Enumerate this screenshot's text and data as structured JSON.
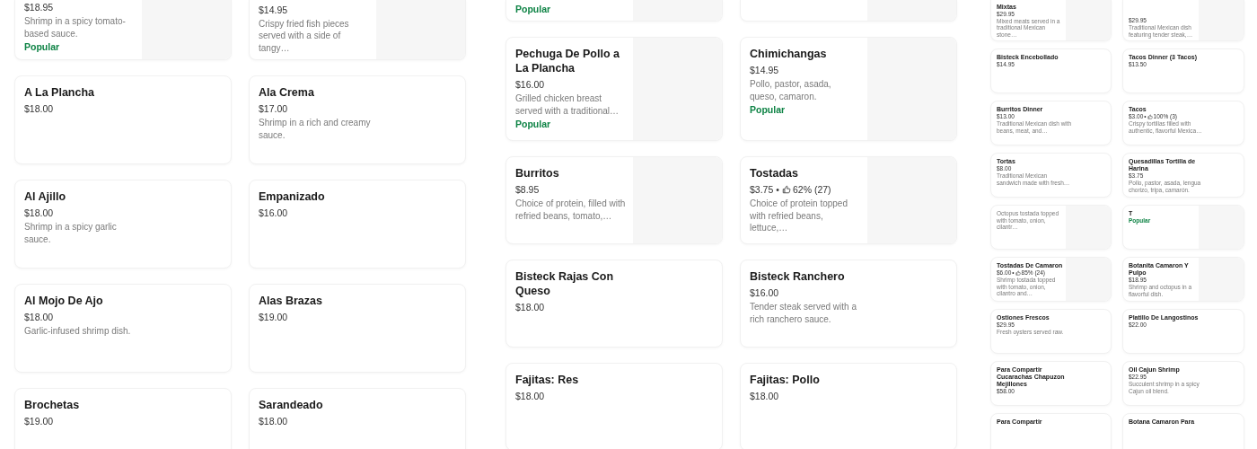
{
  "panels": [
    {
      "top_partial": [
        {
          "price": "$18.95",
          "description": "Shrimp in a spicy tomato-based sauce.",
          "badge": "Popular",
          "image": true
        },
        {
          "price": "$14.95",
          "description": "Crispy fried fish pieces served with a side of tangy…",
          "image": true
        }
      ],
      "rows": [
        [
          {
            "name": "A La Plancha",
            "price": "$18.00",
            "image": false
          },
          {
            "name": "Ala Crema",
            "price": "$17.00",
            "description": "Shrimp in a rich and creamy sauce.",
            "image": false
          }
        ],
        [
          {
            "name": "Al Ajillo",
            "price": "$18.00",
            "description": "Shrimp in a spicy garlic sauce.",
            "image": false
          },
          {
            "name": "Empanizado",
            "price": "$16.00",
            "image": false
          }
        ],
        [
          {
            "name": "Al Mojo De Ajo",
            "price": "$18.00",
            "description": "Garlic-infused shrimp dish.",
            "image": false
          },
          {
            "name": "Alas Brazas",
            "price": "$19.00",
            "image": false
          }
        ],
        [
          {
            "name": "Brochetas",
            "price": "$19.00",
            "image": false
          },
          {
            "name": "Sarandeado",
            "price": "$18.00",
            "image": false
          }
        ]
      ]
    },
    {
      "top_partial": [
        {
          "badge": "Popular",
          "image": true
        },
        {
          "image": true
        }
      ],
      "rows": [
        [
          {
            "name": "Pechuga De Pollo a La Plancha",
            "price": "$16.00",
            "description": "Grilled chicken breast served with a traditional…",
            "badge": "Popular",
            "image": true
          },
          {
            "name": "Chimichangas",
            "price": "$14.95",
            "description": "Pollo, pastor, asada, queso, camaron.",
            "badge": "Popular",
            "image": true
          }
        ],
        [
          {
            "name": "Burritos",
            "price": "$8.95",
            "description": "Choice of protein, filled with refried beans, tomato,…",
            "image": true
          },
          {
            "name": "Tostadas",
            "price": "$3.75",
            "rating_separator": "•",
            "rating": "62% (27)",
            "description": "Choice of protein topped with refried beans, lettuce,…",
            "image": true
          }
        ],
        [
          {
            "name": "Bisteck Rajas Con Queso",
            "price": "$18.00",
            "image": false
          },
          {
            "name": "Bisteck Ranchero",
            "price": "$16.00",
            "description": "Tender steak served with a rich ranchero sauce.",
            "image": false
          }
        ],
        [
          {
            "name": "Fajitas: Res",
            "price": "$18.00",
            "image": false
          },
          {
            "name": "Fajitas: Pollo",
            "price": "$18.00",
            "image": false
          }
        ]
      ]
    },
    {
      "top_partial": [
        {
          "name": "Mixtas",
          "price": "$29.95",
          "description": "Mixed meats served in a traditional Mexican stone…",
          "image": true
        },
        {
          "price": "$29.95",
          "description": "Traditional Mexican dish featuring tender steak,…",
          "image": true
        }
      ],
      "rows": [
        [
          {
            "name": "Bisteck Encebollado",
            "price": "$14.95",
            "image": false
          },
          {
            "name": "Tacos Dinner (3 Tacos)",
            "price": "$13.50",
            "image": false
          }
        ],
        [
          {
            "name": "Burritos Dinner",
            "price": "$13.00",
            "description": "Traditional Mexican dish with beans, meat, and…",
            "image": false
          },
          {
            "name": "Tacos",
            "price": "$3.00",
            "rating_separator": "•",
            "rating": "100% (3)",
            "description": "Crispy tortillas filled with authentic, flavorful Mexica…",
            "image": false
          }
        ],
        [
          {
            "name": "Tortas",
            "price": "$8.00",
            "description": "Traditional Mexican sandwich made with fresh…",
            "image": false
          },
          {
            "name": "Quesadillas Tortilla de Harina",
            "price": "$3.75",
            "description": "Pollo, pastor, asada, lengua chorizo, tripa, camarón.",
            "image": false
          }
        ],
        [
          {
            "description": "Octopus tostada topped with tomato, onion, cilantr…",
            "image": true
          },
          {
            "name": "T",
            "badge": "Popular",
            "image": true
          }
        ],
        [
          {
            "name": "Tostadas De Camaron",
            "price": "$6.00",
            "rating_separator": "•",
            "rating": "85% (24)",
            "description": "Shrimp tostada topped with tomato, onion, cilantro and…",
            "image": true
          },
          {
            "name": "Botanita Camaron Y Pulpo",
            "price": "$18.95",
            "description": "Shrimp and octopus in a flavorful dish.",
            "image": true
          }
        ],
        [
          {
            "name": "Ostiones Frescos",
            "price": "$29.95",
            "description": "Fresh oysters served raw.",
            "image": false
          },
          {
            "name": "Platillo De Langostinos",
            "price": "$22.00",
            "image": false
          }
        ],
        [
          {
            "name": "Para Compartir Cucarachas Chapuzon Mejillones",
            "price": "$58.00",
            "image": false
          },
          {
            "name": "Oil Cajun Shrimp",
            "price": "$22.95",
            "description": "Succulent shrimp in a spicy Cajun oil blend.",
            "image": false
          }
        ],
        [
          {
            "name": "Para Compartir",
            "image": false
          },
          {
            "name": "Botana Camaron Para",
            "image": false
          }
        ]
      ]
    }
  ]
}
